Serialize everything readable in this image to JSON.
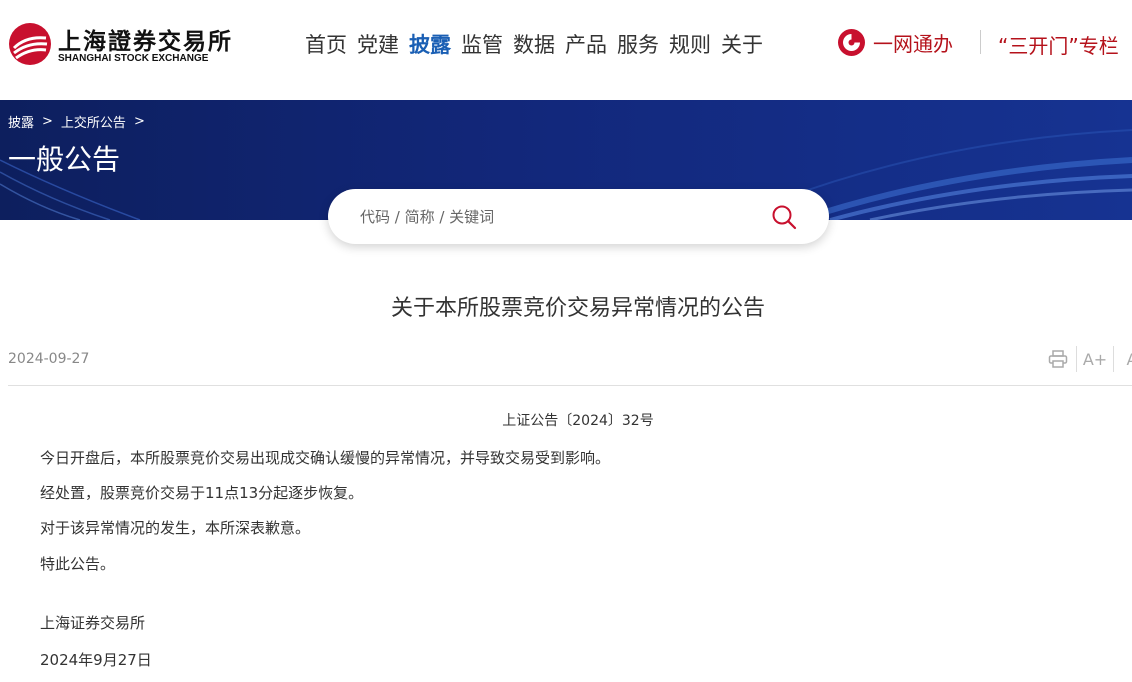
{
  "header": {
    "logo": {
      "cn": "上海證券交易所",
      "en": "SHANGHAI STOCK EXCHANGE"
    },
    "nav": [
      {
        "label": "首页",
        "active": false
      },
      {
        "label": "党建",
        "active": false
      },
      {
        "label": "披露",
        "active": true
      },
      {
        "label": "监管",
        "active": false
      },
      {
        "label": "数据",
        "active": false
      },
      {
        "label": "产品",
        "active": false
      },
      {
        "label": "服务",
        "active": false
      },
      {
        "label": "规则",
        "active": false
      },
      {
        "label": "关于",
        "active": false
      }
    ],
    "service_label": "一网通办",
    "column_label": "“三开门”专栏"
  },
  "banner": {
    "breadcrumb": [
      "披露",
      "上交所公告"
    ],
    "separator": ">",
    "title": "一般公告"
  },
  "search": {
    "placeholder": "代码 / 简称 / 关键词"
  },
  "article": {
    "title": "关于本所股票竞价交易异常情况的公告",
    "date": "2024-09-27",
    "tools": {
      "font_increase": "A+",
      "font_decrease": "A"
    },
    "doc_number": "上证公告〔2024〕32号",
    "paragraphs": [
      "今日开盘后，本所股票竞价交易出现成交确认缓慢的异常情况，并导致交易受到影响。",
      "经处置，股票竞价交易于11点13分起逐步恢复。",
      "对于该异常情况的发生，本所深表歉意。",
      "特此公告。"
    ],
    "signature_org": "上海证券交易所",
    "signature_date": "2024年9月27日"
  },
  "colors": {
    "accent_blue": "#1a5fb4",
    "brand_red": "#c8102e",
    "banner_blue": "#12277a"
  }
}
